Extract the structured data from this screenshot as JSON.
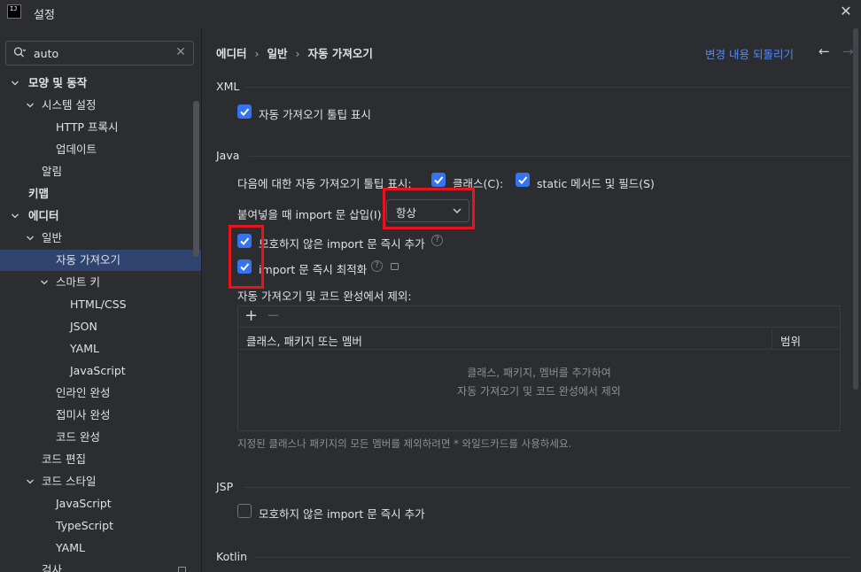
{
  "window": {
    "title": "설정",
    "app_icon_text": "IJ"
  },
  "search": {
    "value": "auto"
  },
  "tree": [
    {
      "label": "모양 및 동작",
      "bold": true,
      "chevron": "down"
    },
    {
      "label": "시스템 설정",
      "bold": false,
      "chevron": "down"
    },
    {
      "label": "HTTP 프록시",
      "bold": false,
      "chevron": ""
    },
    {
      "label": "업데이트",
      "bold": false,
      "chevron": ""
    },
    {
      "label": "알림",
      "bold": false,
      "chevron": ""
    },
    {
      "label": "키맵",
      "bold": true,
      "chevron": ""
    },
    {
      "label": "에디터",
      "bold": true,
      "chevron": "down"
    },
    {
      "label": "일반",
      "bold": false,
      "chevron": "down"
    },
    {
      "label": "자동 가져오기",
      "bold": false,
      "chevron": "",
      "selected": true
    },
    {
      "label": "스마트 키",
      "bold": false,
      "chevron": "down"
    },
    {
      "label": "HTML/CSS",
      "bold": false,
      "chevron": ""
    },
    {
      "label": "JSON",
      "bold": false,
      "chevron": ""
    },
    {
      "label": "YAML",
      "bold": false,
      "chevron": ""
    },
    {
      "label": "JavaScript",
      "bold": false,
      "chevron": ""
    },
    {
      "label": "인라인 완성",
      "bold": false,
      "chevron": ""
    },
    {
      "label": "접미사 완성",
      "bold": false,
      "chevron": ""
    },
    {
      "label": "코드 완성",
      "bold": false,
      "chevron": ""
    },
    {
      "label": "코드 편집",
      "bold": false,
      "chevron": ""
    },
    {
      "label": "코드 스타일",
      "bold": false,
      "chevron": "down"
    },
    {
      "label": "JavaScript",
      "bold": false,
      "chevron": ""
    },
    {
      "label": "TypeScript",
      "bold": false,
      "chevron": ""
    },
    {
      "label": "YAML",
      "bold": false,
      "chevron": ""
    },
    {
      "label": "검사",
      "bold": false,
      "chevron": ""
    }
  ],
  "breadcrumb": [
    "에디터",
    "일반",
    "자동 가져오기"
  ],
  "revert_link": "변경 내용 되돌리기",
  "nav": {
    "back": "←",
    "forward": "→"
  },
  "xml": {
    "title": "XML",
    "show_popup": {
      "label": "자동 가져오기 툴팁 표시",
      "checked": true
    }
  },
  "java": {
    "title": "Java",
    "show_popup_for": "다음에 대한 자동 가져오기 툴팁 표시:",
    "classes": {
      "label": "클래스(C):",
      "checked": true
    },
    "static": {
      "label": "static 메서드 및 필드(S)",
      "checked": true
    },
    "insert_on_paste_label": "붙여넣을 때 import 문 삽입(I):",
    "insert_on_paste_value": "항상",
    "add_unambiguous": {
      "label": "모호하지 않은 import 문 즉시 추가",
      "checked": true
    },
    "optimize_imports": {
      "label": "import 문 즉시 최적화",
      "checked": true
    },
    "exclude_label": "자동 가져오기 및 코드 완성에서 제외:",
    "table": {
      "col1": "클래스, 패키지 또는 멤버",
      "col2": "범위",
      "empty_line1": "클래스, 패키지, 멤버를 추가하여",
      "empty_line2": "자동 가져오기 및 코드 완성에서 제외"
    },
    "hint": "지정된 클래스나 패키지의 모든 멤버를 제외하려면 * 와일드카드를 사용하세요."
  },
  "jsp": {
    "title": "JSP",
    "add_unambiguous": {
      "label": "모호하지 않은 import 문 즉시 추가",
      "checked": false
    }
  },
  "kotlin": {
    "title": "Kotlin"
  },
  "colors": {
    "accent": "#3574f0",
    "link": "#548af7",
    "highlight_box": "#e8141c",
    "selection": "#2e436e"
  }
}
